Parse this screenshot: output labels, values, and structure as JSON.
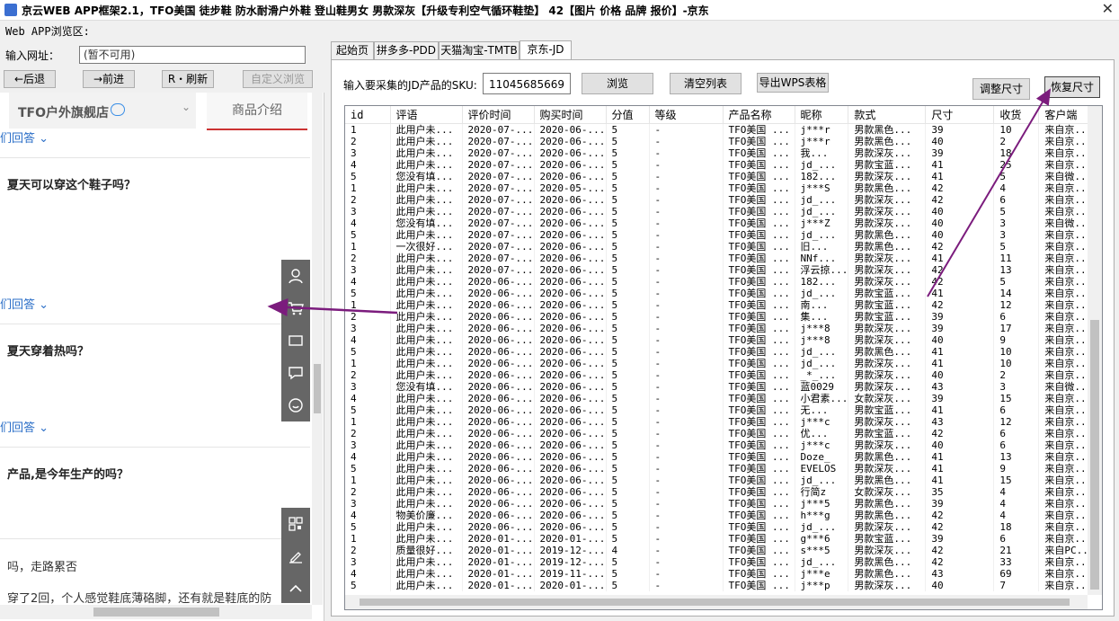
{
  "window": {
    "title": "京云WEB APP框架2.1，TFO美国 徒步鞋 防水耐滑户外鞋 登山鞋男女 男款深灰【升级专利空气循环鞋垫】 42【图片 价格 品牌 报价】-京东",
    "close": "✕"
  },
  "browser_section_label": "Web APP浏览区:",
  "url_label": "输入网址：",
  "url_placeholder": "(暂不可用)",
  "nav": {
    "back": "←后退",
    "forward": "→前进",
    "refresh": "R・刷新",
    "custom": "自定义浏览"
  },
  "web": {
    "shop_name": "TFO户外旗舰店",
    "intro_tab": "商品介绍",
    "answer_link": "们回答",
    "q1": "夏天可以穿这个鞋子吗？",
    "q2": "夏天穿着热吗？",
    "q3": "产品,是今年生产的吗？",
    "a4": "吗，走路累否",
    "a5": "穿了2回，个人感觉鞋底薄硌脚，还有就是鞋底的防"
  },
  "tabs": [
    "起始页",
    "拼多多-PDD",
    "天猫淘宝-TMTB",
    "京东-JD"
  ],
  "jd": {
    "sku_label": "输入要采集的JD产品的SKU:",
    "sku_value": "11045685669",
    "browse": "浏览",
    "clear": "清空列表",
    "export": "导出WPS表格",
    "adjust": "调整尺寸",
    "restore": "恢复尺寸"
  },
  "grid": {
    "columns": [
      "id",
      "评语",
      "评价时间",
      "购买时间",
      "分值",
      "等级",
      "产品名称",
      "昵称",
      "款式",
      "尺寸",
      "收货",
      "客户端"
    ],
    "rows": [
      [
        "1",
        "此用户未...",
        "2020-07-...",
        "2020-06-...",
        "5",
        "-",
        "TFO美国 ...",
        "j***r",
        "男款黑色...",
        "39",
        "10",
        "来自京..."
      ],
      [
        "2",
        "此用户未...",
        "2020-07-...",
        "2020-06-...",
        "5",
        "-",
        "TFO美国 ...",
        "j***r",
        "男款黑色...",
        "40",
        "2",
        "来自京..."
      ],
      [
        "3",
        "此用户未...",
        "2020-07-...",
        "2020-06-...",
        "5",
        "-",
        "TFO美国 ...",
        "我...",
        "男款深灰...",
        "39",
        "18",
        "来自京..."
      ],
      [
        "4",
        "此用户未...",
        "2020-07-...",
        "2020-06-...",
        "5",
        "-",
        "TFO美国 ...",
        "jd_...",
        "男款宝蓝...",
        "41",
        "25",
        "来自京..."
      ],
      [
        "5",
        "您没有填...",
        "2020-07-...",
        "2020-06-...",
        "5",
        "-",
        "TFO美国 ...",
        "182...",
        "男款深灰...",
        "41",
        "5",
        "来自微..."
      ],
      [
        "1",
        "此用户未...",
        "2020-07-...",
        "2020-05-...",
        "5",
        "-",
        "TFO美国 ...",
        "j***S",
        "男款黑色...",
        "42",
        "4",
        "来自京..."
      ],
      [
        "2",
        "此用户未...",
        "2020-07-...",
        "2020-06-...",
        "5",
        "-",
        "TFO美国 ...",
        "jd_...",
        "男款深灰...",
        "42",
        "6",
        "来自京..."
      ],
      [
        "3",
        "此用户未...",
        "2020-07-...",
        "2020-06-...",
        "5",
        "-",
        "TFO美国 ...",
        "jd_...",
        "男款深灰...",
        "40",
        "5",
        "来自京..."
      ],
      [
        "4",
        "您没有填...",
        "2020-07-...",
        "2020-06-...",
        "5",
        "-",
        "TFO美国 ...",
        "j***Z",
        "男款深灰...",
        "40",
        "3",
        "来自微..."
      ],
      [
        "5",
        "此用户未...",
        "2020-07-...",
        "2020-06-...",
        "5",
        "-",
        "TFO美国 ...",
        "jd_...",
        "男款黑色...",
        "40",
        "3",
        "来自京..."
      ],
      [
        "1",
        "一次很好...",
        "2020-07-...",
        "2020-06-...",
        "5",
        "-",
        "TFO美国 ...",
        "旧...",
        "男款黑色...",
        "42",
        "5",
        "来自京..."
      ],
      [
        "2",
        "此用户未...",
        "2020-07-...",
        "2020-06-...",
        "5",
        "-",
        "TFO美国 ...",
        "NNf...",
        "男款深灰...",
        "41",
        "11",
        "来自京..."
      ],
      [
        "3",
        "此用户未...",
        "2020-07-...",
        "2020-06-...",
        "5",
        "-",
        "TFO美国 ...",
        "浮云掠...",
        "男款深灰...",
        "42",
        "13",
        "来自京..."
      ],
      [
        "4",
        "此用户未...",
        "2020-06-...",
        "2020-06-...",
        "5",
        "-",
        "TFO美国 ...",
        "182...",
        "男款深灰...",
        "42",
        "5",
        "来自京..."
      ],
      [
        "5",
        "此用户未...",
        "2020-06-...",
        "2020-06-...",
        "5",
        "-",
        "TFO美国 ...",
        "jd_...",
        "男款宝蓝...",
        "41",
        "14",
        "来自京..."
      ],
      [
        "1",
        "此用户未...",
        "2020-06-...",
        "2020-06-...",
        "5",
        "-",
        "TFO美国 ...",
        "南...",
        "男款宝蓝...",
        "42",
        "12",
        "来自京..."
      ],
      [
        "2",
        "此用户未...",
        "2020-06-...",
        "2020-06-...",
        "5",
        "-",
        "TFO美国 ...",
        "集...",
        "男款宝蓝...",
        "39",
        "6",
        "来自京..."
      ],
      [
        "3",
        "此用户未...",
        "2020-06-...",
        "2020-06-...",
        "5",
        "-",
        "TFO美国 ...",
        "j***8",
        "男款深灰...",
        "39",
        "17",
        "来自京..."
      ],
      [
        "4",
        "此用户未...",
        "2020-06-...",
        "2020-06-...",
        "5",
        "-",
        "TFO美国 ...",
        "j***8",
        "男款深灰...",
        "40",
        "9",
        "来自京..."
      ],
      [
        "5",
        "此用户未...",
        "2020-06-...",
        "2020-06-...",
        "5",
        "-",
        "TFO美国 ...",
        "jd_...",
        "男款黑色...",
        "41",
        "10",
        "来自京..."
      ],
      [
        "1",
        "此用户未...",
        "2020-06-...",
        "2020-06-...",
        "5",
        "-",
        "TFO美国 ...",
        "jd_...",
        "男款深灰...",
        "41",
        "10",
        "来自京..."
      ],
      [
        "2",
        "此用户未...",
        "2020-06-...",
        "2020-06-...",
        "5",
        "-",
        "TFO美国 ...",
        "_*_...",
        "男款深灰...",
        "40",
        "2",
        "来自京..."
      ],
      [
        "3",
        "您没有填...",
        "2020-06-...",
        "2020-06-...",
        "5",
        "-",
        "TFO美国 ...",
        "蓝0029",
        "男款深灰...",
        "43",
        "3",
        "来自微..."
      ],
      [
        "4",
        "此用户未...",
        "2020-06-...",
        "2020-06-...",
        "5",
        "-",
        "TFO美国 ...",
        "小君素...",
        "女款深灰...",
        "39",
        "15",
        "来自京..."
      ],
      [
        "5",
        "此用户未...",
        "2020-06-...",
        "2020-06-...",
        "5",
        "-",
        "TFO美国 ...",
        "无...",
        "男款宝蓝...",
        "41",
        "6",
        "来自京..."
      ],
      [
        "1",
        "此用户未...",
        "2020-06-...",
        "2020-06-...",
        "5",
        "-",
        "TFO美国 ...",
        "j***c",
        "男款深灰...",
        "43",
        "12",
        "来自京..."
      ],
      [
        "2",
        "此用户未...",
        "2020-06-...",
        "2020-06-...",
        "5",
        "-",
        "TFO美国 ...",
        "优...",
        "男款宝蓝...",
        "42",
        "6",
        "来自京..."
      ],
      [
        "3",
        "此用户未...",
        "2020-06-...",
        "2020-06-...",
        "5",
        "-",
        "TFO美国 ...",
        "j***c",
        "男款深灰...",
        "40",
        "6",
        "来自京..."
      ],
      [
        "4",
        "此用户未...",
        "2020-06-...",
        "2020-06-...",
        "5",
        "-",
        "TFO美国 ...",
        "Doze_",
        "男款黑色...",
        "41",
        "13",
        "来自京..."
      ],
      [
        "5",
        "此用户未...",
        "2020-06-...",
        "2020-06-...",
        "5",
        "-",
        "TFO美国 ...",
        "EVELOS",
        "男款深灰...",
        "41",
        "9",
        "来自京..."
      ],
      [
        "1",
        "此用户未...",
        "2020-06-...",
        "2020-06-...",
        "5",
        "-",
        "TFO美国 ...",
        "jd_...",
        "男款黑色...",
        "41",
        "15",
        "来自京..."
      ],
      [
        "2",
        "此用户未...",
        "2020-06-...",
        "2020-06-...",
        "5",
        "-",
        "TFO美国 ...",
        "行简z",
        "女款深灰...",
        "35",
        "4",
        "来自京..."
      ],
      [
        "3",
        "此用户未...",
        "2020-06-...",
        "2020-06-...",
        "5",
        "-",
        "TFO美国 ...",
        "j***5",
        "男款黑色...",
        "39",
        "4",
        "来自京..."
      ],
      [
        "4",
        "物美价廉...",
        "2020-06-...",
        "2020-06-...",
        "5",
        "-",
        "TFO美国 ...",
        "h***g",
        "男款黑色...",
        "42",
        "4",
        "来自京..."
      ],
      [
        "5",
        "此用户未...",
        "2020-06-...",
        "2020-06-...",
        "5",
        "-",
        "TFO美国 ...",
        "jd_...",
        "男款深灰...",
        "42",
        "18",
        "来自京..."
      ],
      [
        "1",
        "此用户未...",
        "2020-01-...",
        "2020-01-...",
        "5",
        "-",
        "TFO美国 ...",
        "g***6",
        "男款宝蓝...",
        "39",
        "6",
        "来自京..."
      ],
      [
        "2",
        "质量很好...",
        "2020-01-...",
        "2019-12-...",
        "4",
        "-",
        "TFO美国 ...",
        "s***5",
        "男款深灰...",
        "42",
        "21",
        "来自PC..."
      ],
      [
        "3",
        "此用户未...",
        "2020-01-...",
        "2019-12-...",
        "5",
        "-",
        "TFO美国 ...",
        "jd_...",
        "男款黑色...",
        "42",
        "33",
        "来自京..."
      ],
      [
        "4",
        "此用户未...",
        "2020-01-...",
        "2019-11-...",
        "5",
        "-",
        "TFO美国 ...",
        "j***e",
        "男款黑色...",
        "43",
        "69",
        "来自京..."
      ],
      [
        "5",
        "此用户未...",
        "2020-01-...",
        "2020-01-...",
        "5",
        "-",
        "TFO美国 ...",
        "j***p",
        "男款深灰...",
        "40",
        "7",
        "来自京..."
      ]
    ]
  },
  "colors": {
    "arrow": "#7b1c7d",
    "link": "#2a6ec7",
    "accent": "#cc3333"
  }
}
